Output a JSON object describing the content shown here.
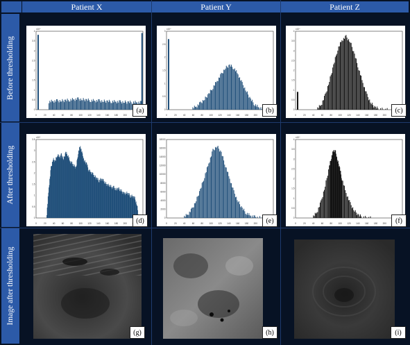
{
  "columns": [
    "Patient X",
    "Patient Y",
    "Patient Z"
  ],
  "rows": [
    "Before thresholding",
    "After thresholding",
    "Image after thresholding"
  ],
  "panel_tags": [
    "(a)",
    "(b)",
    "(c)",
    "(d)",
    "(e)",
    "(f)",
    "(g)",
    "(h)",
    "(i)"
  ],
  "colors": {
    "header": "#2c5aa8",
    "background": "#071224",
    "bar_blue": "#1f4e79",
    "bar_black": "#111111"
  },
  "chart_data": [
    {
      "type": "bar",
      "panel": "(a)",
      "color": "#1f4e79",
      "ylim": [
        0,
        4.4
      ],
      "xlim": [
        0,
        255
      ],
      "y_scale_label": "x10⁴",
      "xticks": [
        "0",
        "20",
        "40",
        "60",
        "80",
        "100",
        "120",
        "140",
        "160",
        "180",
        "200",
        "220",
        "240"
      ],
      "yticks": [
        "0",
        "0.5",
        "1",
        "1.5",
        "2",
        "2.5",
        "3",
        "3.5",
        "4"
      ],
      "spikes": [
        {
          "x": 5,
          "y": 4.2
        },
        {
          "x": 253,
          "y": 4.3
        }
      ],
      "x": [
        30,
        40,
        50,
        60,
        70,
        80,
        90,
        100,
        110,
        120,
        130,
        140,
        150,
        160,
        170,
        180,
        190,
        200,
        210,
        220,
        230,
        240,
        250
      ],
      "values": [
        0.45,
        0.48,
        0.5,
        0.5,
        0.52,
        0.55,
        0.58,
        0.6,
        0.57,
        0.55,
        0.52,
        0.5,
        0.5,
        0.48,
        0.47,
        0.46,
        0.45,
        0.44,
        0.43,
        0.42,
        0.42,
        0.41,
        0.4
      ]
    },
    {
      "type": "bar",
      "panel": "(b)",
      "color": "#1f4e79",
      "ylim": [
        0,
        3
      ],
      "xlim": [
        0,
        255
      ],
      "y_scale_label": "x10⁴",
      "xticks": [
        "0",
        "20",
        "40",
        "60",
        "80",
        "100",
        "120",
        "140",
        "160",
        "180",
        "200",
        "220",
        "240"
      ],
      "yticks": [
        "0",
        "0.5",
        "1",
        "1.5",
        "2",
        "2.5",
        "3"
      ],
      "spikes": [
        {
          "x": 5,
          "y": 2.7
        }
      ],
      "x": [
        60,
        70,
        80,
        90,
        100,
        110,
        120,
        130,
        140,
        150,
        160,
        170,
        180,
        190,
        200,
        210,
        220,
        230
      ],
      "values": [
        0.05,
        0.12,
        0.25,
        0.4,
        0.6,
        0.85,
        1.1,
        1.35,
        1.6,
        1.7,
        1.6,
        1.35,
        1.0,
        0.7,
        0.4,
        0.2,
        0.08,
        0.03
      ]
    },
    {
      "type": "bar",
      "panel": "(c)",
      "color": "#111111",
      "ylim": [
        0,
        4.4
      ],
      "xlim": [
        0,
        255
      ],
      "y_scale_label": "x10⁴",
      "xticks": [
        "0",
        "20",
        "40",
        "60",
        "80",
        "100",
        "120",
        "140",
        "160",
        "180",
        "200",
        "220",
        "240"
      ],
      "yticks": [
        "0",
        "0.5",
        "1",
        "1.5",
        "2",
        "2.5",
        "3",
        "3.5",
        "4"
      ],
      "spikes": [
        {
          "x": 5,
          "y": 1.0
        }
      ],
      "x": [
        50,
        60,
        70,
        80,
        90,
        100,
        110,
        120,
        130,
        140,
        150,
        160,
        170,
        180,
        190,
        200,
        210
      ],
      "values": [
        0.05,
        0.25,
        0.8,
        1.6,
        2.5,
        3.4,
        3.9,
        4.1,
        3.8,
        3.1,
        2.3,
        1.5,
        0.8,
        0.35,
        0.12,
        0.04,
        0.01
      ]
    },
    {
      "type": "bar",
      "panel": "(d)",
      "color": "#1f4e79",
      "ylim": [
        0,
        3.6
      ],
      "xlim": [
        0,
        255
      ],
      "y_scale_label": "x10⁴",
      "xticks": [
        "0",
        "20",
        "40",
        "60",
        "80",
        "100",
        "120",
        "140",
        "160",
        "180",
        "200",
        "220",
        "240"
      ],
      "yticks": [
        "0",
        "0.5",
        "1",
        "1.5",
        "2",
        "2.5",
        "3",
        "3.5"
      ],
      "spikes": [],
      "x": [
        25,
        30,
        35,
        40,
        45,
        50,
        55,
        60,
        65,
        70,
        75,
        80,
        85,
        90,
        95,
        100,
        105,
        110,
        115,
        120,
        125,
        130,
        135,
        140,
        145,
        150,
        155,
        160,
        165,
        170,
        175,
        180,
        185,
        190,
        195,
        200,
        205,
        210,
        215,
        220,
        225,
        230,
        235,
        240
      ],
      "values": [
        0.2,
        1.4,
        2.3,
        2.7,
        2.6,
        2.9,
        2.8,
        2.9,
        2.7,
        3.0,
        2.9,
        2.6,
        2.5,
        2.4,
        2.3,
        3.0,
        3.3,
        2.9,
        2.6,
        2.5,
        2.2,
        2.1,
        2.0,
        1.9,
        1.8,
        1.7,
        1.8,
        1.7,
        1.6,
        1.5,
        1.5,
        1.4,
        1.4,
        1.3,
        1.35,
        1.3,
        1.2,
        1.1,
        1.15,
        1.1,
        1.0,
        1.0,
        0.9,
        0.6
      ]
    },
    {
      "type": "bar",
      "panel": "(e)",
      "color": "#1f4e79",
      "ylim": [
        0,
        18000
      ],
      "xlim": [
        0,
        255
      ],
      "y_scale_label": "",
      "xticks": [
        "0",
        "20",
        "40",
        "60",
        "80",
        "100",
        "120",
        "140",
        "160",
        "180",
        "200",
        "220",
        "240"
      ],
      "yticks": [
        "0",
        "2000",
        "4000",
        "6000",
        "8000",
        "10000",
        "12000",
        "14000",
        "16000",
        "18000"
      ],
      "spikes": [],
      "x": [
        40,
        50,
        60,
        70,
        80,
        90,
        100,
        110,
        120,
        130,
        140,
        150,
        160,
        170,
        180,
        190,
        200,
        210,
        220
      ],
      "values": [
        200,
        800,
        2000,
        4000,
        6500,
        9500,
        12500,
        15500,
        16500,
        15000,
        12000,
        9000,
        6000,
        3800,
        2200,
        1100,
        500,
        200,
        80
      ]
    },
    {
      "type": "bar",
      "panel": "(f)",
      "color": "#111111",
      "ylim": [
        0,
        4.4
      ],
      "xlim": [
        0,
        255
      ],
      "y_scale_label": "x10⁴",
      "xticks": [
        "0",
        "20",
        "40",
        "60",
        "80",
        "100",
        "120",
        "140",
        "160",
        "180",
        "200",
        "220",
        "240"
      ],
      "yticks": [
        "0",
        "0.5",
        "1",
        "1.5",
        "2",
        "2.5",
        "3",
        "3.5",
        "4"
      ],
      "spikes": [],
      "x": [
        40,
        50,
        60,
        70,
        80,
        85,
        90,
        95,
        100,
        105,
        110,
        120,
        130,
        140,
        150,
        160,
        170
      ],
      "values": [
        0.05,
        0.3,
        0.9,
        1.8,
        2.9,
        3.4,
        3.8,
        3.7,
        3.2,
        2.8,
        2.2,
        1.4,
        0.8,
        0.4,
        0.15,
        0.05,
        0.02
      ]
    }
  ]
}
